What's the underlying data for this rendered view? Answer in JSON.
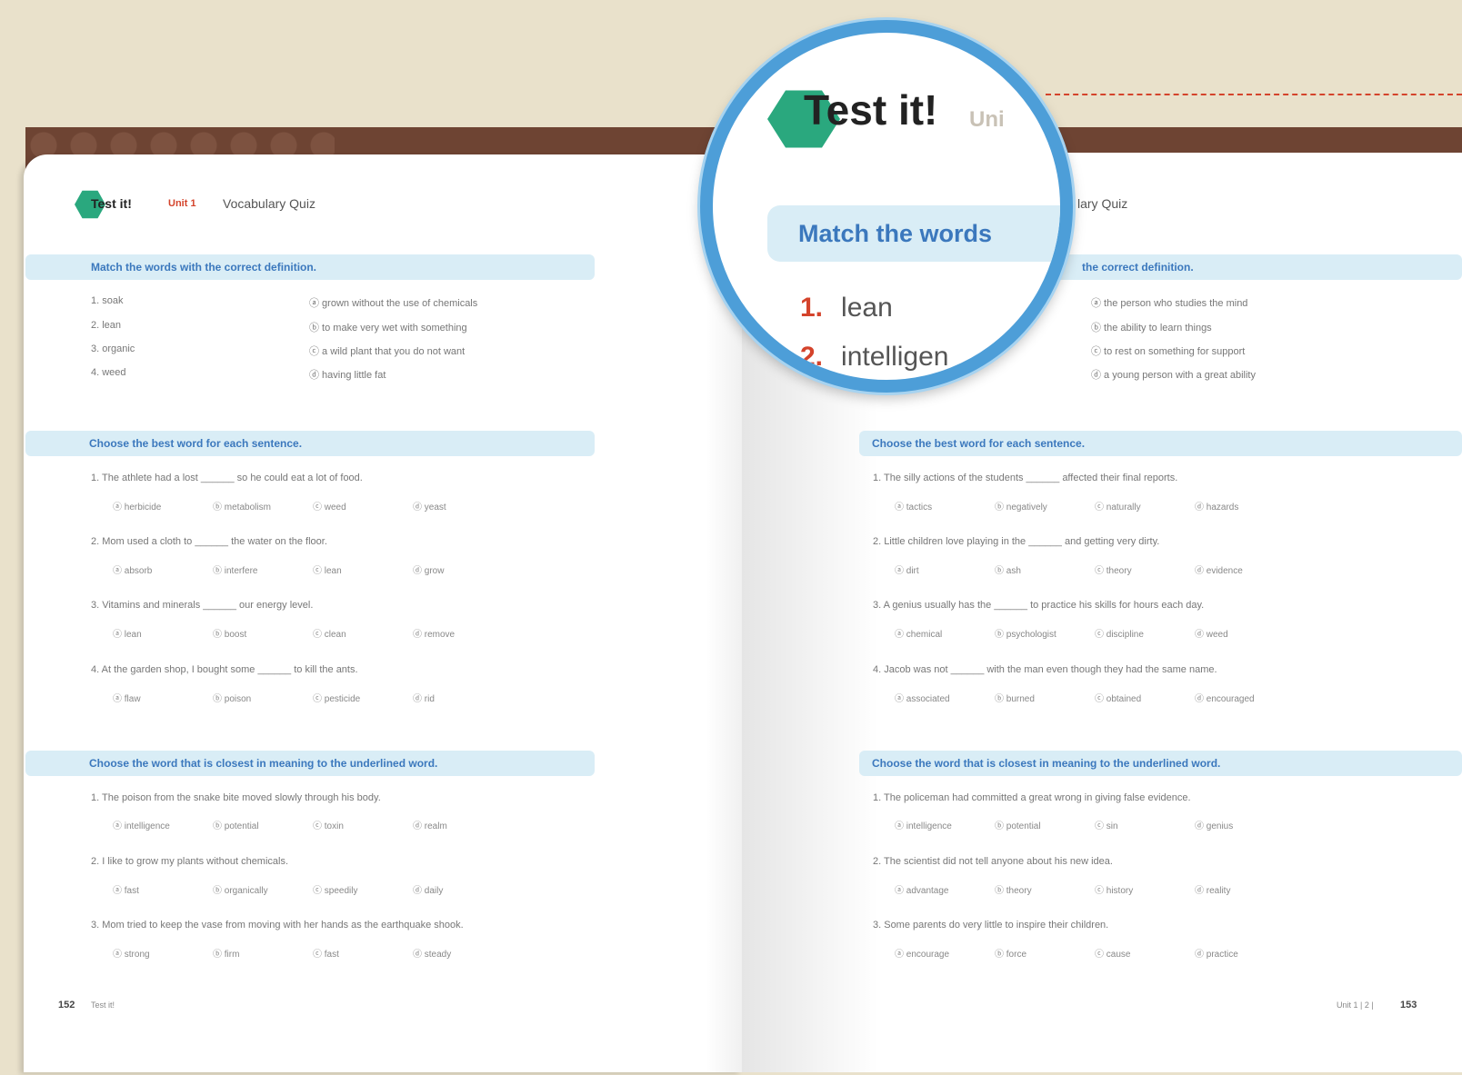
{
  "left_page": {
    "header": {
      "title": "Test it!",
      "unit": "Unit 1",
      "subtitle": "Vocabulary Quiz"
    },
    "section1": {
      "title": "Match the words with the correct definition.",
      "words": [
        "1. soak",
        "2. lean",
        "3. organic",
        "4. weed"
      ],
      "definitions": [
        "ⓐ grown without the use of chemicals",
        "ⓑ to make very wet with something",
        "ⓒ a wild plant that you do not want",
        "ⓓ having little fat"
      ]
    },
    "section2": {
      "title": "Choose the best word for each sentence.",
      "questions": [
        {
          "q": "1. The athlete had a lost ______ so he could eat a lot of food.",
          "opts": [
            "ⓐ herbicide",
            "ⓑ metabolism",
            "ⓒ weed",
            "ⓓ yeast"
          ]
        },
        {
          "q": "2. Mom used a cloth to ______ the water on the floor.",
          "opts": [
            "ⓐ absorb",
            "ⓑ interfere",
            "ⓒ lean",
            "ⓓ grow"
          ]
        },
        {
          "q": "3. Vitamins and minerals ______ our energy level.",
          "opts": [
            "ⓐ lean",
            "ⓑ boost",
            "ⓒ clean",
            "ⓓ remove"
          ]
        },
        {
          "q": "4. At the garden shop, I bought some ______ to kill the ants.",
          "opts": [
            "ⓐ flaw",
            "ⓑ poison",
            "ⓒ pesticide",
            "ⓓ rid"
          ]
        }
      ]
    },
    "section3": {
      "title": "Choose the word that is closest in meaning to the underlined word.",
      "questions": [
        {
          "q": "1. The poison from the snake bite moved slowly through his body.",
          "opts": [
            "ⓐ intelligence",
            "ⓑ potential",
            "ⓒ toxin",
            "ⓓ realm"
          ]
        },
        {
          "q": "2. I like to grow my plants without chemicals.",
          "opts": [
            "ⓐ fast",
            "ⓑ organically",
            "ⓒ speedily",
            "ⓓ daily"
          ]
        },
        {
          "q": "3. Mom tried to keep the vase from moving with her hands as the earthquake shook.",
          "opts": [
            "ⓐ strong",
            "ⓑ firm",
            "ⓒ fast",
            "ⓓ steady"
          ]
        }
      ]
    },
    "page_number": "152",
    "footer_label": "Test it!"
  },
  "right_page": {
    "header_fragment": "lary Quiz",
    "section1": {
      "title": "the correct definition.",
      "definitions": [
        "ⓐ the person who studies the mind",
        "ⓑ the ability to learn things",
        "ⓒ to rest on something for support",
        "ⓓ a young person with a great ability"
      ]
    },
    "section2": {
      "title": "Choose the best word for each sentence.",
      "questions": [
        {
          "q": "1. The silly actions of the students ______ affected their final reports.",
          "opts": [
            "ⓐ tactics",
            "ⓑ negatively",
            "ⓒ naturally",
            "ⓓ hazards"
          ]
        },
        {
          "q": "2. Little children love playing in the ______ and getting very dirty.",
          "opts": [
            "ⓐ dirt",
            "ⓑ ash",
            "ⓒ theory",
            "ⓓ evidence"
          ]
        },
        {
          "q": "3. A genius usually has the ______ to practice his skills for hours each day.",
          "opts": [
            "ⓐ chemical",
            "ⓑ psychologist",
            "ⓒ discipline",
            "ⓓ weed"
          ]
        },
        {
          "q": "4. Jacob was not ______ with the man even though they had the same name.",
          "opts": [
            "ⓐ associated",
            "ⓑ burned",
            "ⓒ obtained",
            "ⓓ encouraged"
          ]
        }
      ]
    },
    "section3": {
      "title": "Choose the word that is closest in meaning to the underlined word.",
      "questions": [
        {
          "q": "1. The policeman had committed a great wrong in giving false evidence.",
          "opts": [
            "ⓐ intelligence",
            "ⓑ potential",
            "ⓒ sin",
            "ⓓ genius"
          ]
        },
        {
          "q": "2. The scientist did not tell anyone about his new idea.",
          "opts": [
            "ⓐ advantage",
            "ⓑ theory",
            "ⓒ history",
            "ⓓ reality"
          ]
        },
        {
          "q": "3. Some parents do very little to inspire their children.",
          "opts": [
            "ⓐ encourage",
            "ⓑ force",
            "ⓒ cause",
            "ⓓ practice"
          ]
        }
      ]
    },
    "page_number": "153",
    "footer_label": "Unit 1 | 2 |"
  },
  "magnifier": {
    "title": "Test it!",
    "unit": "Uni",
    "bar_text": "Match the words",
    "rows": [
      {
        "num": "1.",
        "word": "lean"
      },
      {
        "num": "2.",
        "word": "intelligen"
      }
    ]
  },
  "colors": {
    "accent_blue": "#3b78bd",
    "accent_red": "#d4432b",
    "band": "#d9edf6",
    "logo_green": "#2aa87e",
    "brown": "#6e4433"
  }
}
